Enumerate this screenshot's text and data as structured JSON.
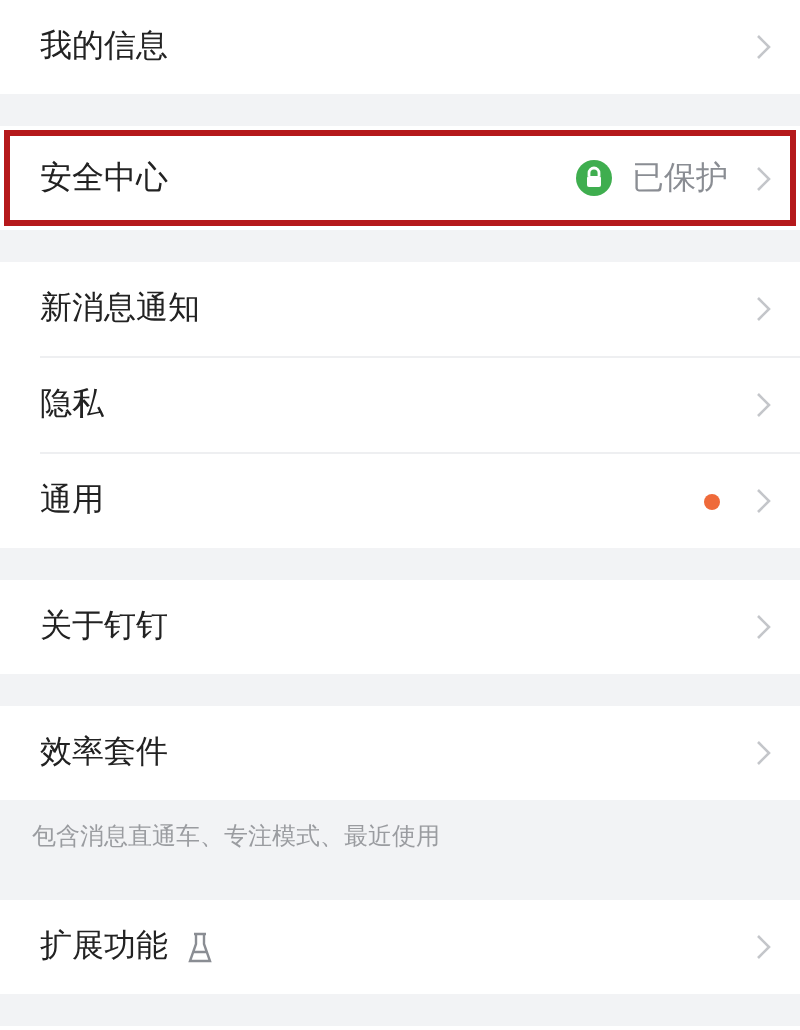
{
  "groups": [
    {
      "items": [
        {
          "label": "我的信息",
          "highlighted": false
        }
      ]
    },
    {
      "items": [
        {
          "label": "安全中心",
          "highlighted": true,
          "status": "已保护",
          "locked": true
        }
      ]
    },
    {
      "items": [
        {
          "label": "新消息通知",
          "highlighted": false
        },
        {
          "label": "隐私",
          "highlighted": false
        },
        {
          "label": "通用",
          "highlighted": false,
          "color": "#ef6a3a"
        }
      ]
    },
    {
      "items": [
        {
          "label": "关于钉钉",
          "highlighted": false
        }
      ]
    },
    {
      "items": [
        {
          "label": "效率套件",
          "highlighted": false
        }
      ],
      "note": "包含消息直通车、专注模式、最近使用"
    },
    {
      "items": [
        {
          "label": "扩展功能",
          "highlighted": false,
          "experimental": true
        }
      ]
    }
  ]
}
